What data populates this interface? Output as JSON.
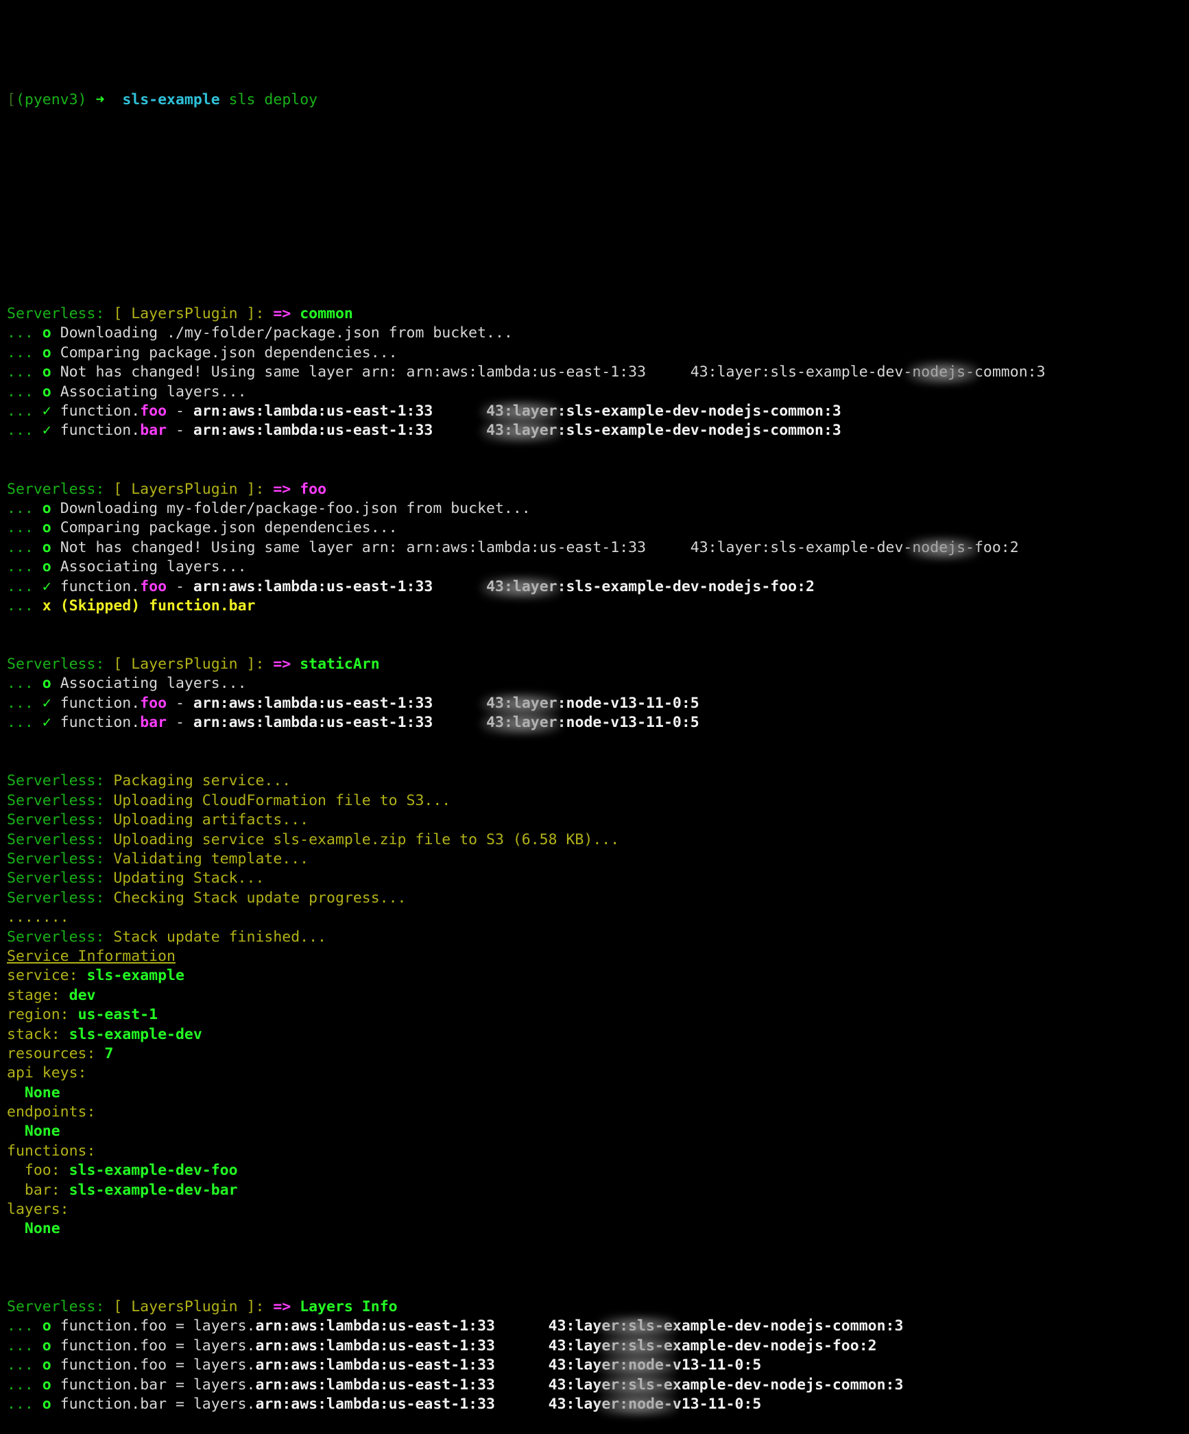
{
  "terminal": {
    "theme": {
      "background": "#000000",
      "green": "#18b218",
      "bright_green": "#23fd23",
      "yellow": "#b2b218",
      "bright_yellow": "#f0f023",
      "cyan": "#2fc0d8",
      "magenta": "#e619e6",
      "white": "#d8d8d8"
    },
    "prompt": {
      "bracket": "[",
      "venv": "(pyenv3)",
      "arrow": "➜",
      "cwd": "sls-example",
      "command": "sls deploy"
    },
    "account_redacted": true,
    "arn_prefix": "arn:aws:lambda:us-east-1:33",
    "arn_suffix_digits": "43",
    "blocks": [
      {
        "header": {
          "prefix": "Serverless:",
          "plugin": "[ LayersPlugin ]:",
          "arrow": "=>",
          "name": "common",
          "name_color": "bright_green"
        },
        "lines": [
          {
            "kind": "info",
            "bullet": "o",
            "text": "Downloading ./my-folder/package.json from bucket..."
          },
          {
            "kind": "info",
            "bullet": "o",
            "text": "Comparing package.json dependencies..."
          },
          {
            "kind": "arn-info",
            "bullet": "o",
            "text": "Not has changed! Using same layer arn: ",
            "arn_tail": ":layer:sls-example-dev-nodejs-common:3"
          },
          {
            "kind": "info",
            "bullet": "o",
            "text": "Associating layers..."
          },
          {
            "kind": "ok-arn",
            "bullet": "✓",
            "fn_prefix": "function.",
            "fn": "foo",
            "sep": " - ",
            "arn_tail": ":layer:sls-example-dev-nodejs-common:3"
          },
          {
            "kind": "ok-arn",
            "bullet": "✓",
            "fn_prefix": "function.",
            "fn": "bar",
            "sep": " - ",
            "arn_tail": ":layer:sls-example-dev-nodejs-common:3"
          }
        ]
      },
      {
        "header": {
          "prefix": "Serverless:",
          "plugin": "[ LayersPlugin ]:",
          "arrow": "=>",
          "name": "foo",
          "name_color": "magenta"
        },
        "lines": [
          {
            "kind": "info",
            "bullet": "o",
            "text": "Downloading my-folder/package-foo.json from bucket..."
          },
          {
            "kind": "info",
            "bullet": "o",
            "text": "Comparing package.json dependencies..."
          },
          {
            "kind": "arn-info",
            "bullet": "o",
            "text": "Not has changed! Using same layer arn: ",
            "arn_tail": ":layer:sls-example-dev-nodejs-foo:2"
          },
          {
            "kind": "info",
            "bullet": "o",
            "text": "Associating layers..."
          },
          {
            "kind": "ok-arn",
            "bullet": "✓",
            "fn_prefix": "function.",
            "fn": "foo",
            "sep": " - ",
            "arn_tail": ":layer:sls-example-dev-nodejs-foo:2"
          },
          {
            "kind": "skip",
            "bullet": "x",
            "text": "(Skipped) function.bar"
          }
        ]
      },
      {
        "header": {
          "prefix": "Serverless:",
          "plugin": "[ LayersPlugin ]:",
          "arrow": "=>",
          "name": "staticArn",
          "name_color": "bright_green"
        },
        "lines": [
          {
            "kind": "info",
            "bullet": "o",
            "text": "Associating layers..."
          },
          {
            "kind": "ok-arn",
            "bullet": "✓",
            "fn_prefix": "function.",
            "fn": "foo",
            "sep": " - ",
            "arn_tail": ":layer:node-v13-11-0:5"
          },
          {
            "kind": "ok-arn",
            "bullet": "✓",
            "fn_prefix": "function.",
            "fn": "bar",
            "sep": " - ",
            "arn_tail": ":layer:node-v13-11-0:5"
          }
        ]
      }
    ],
    "status_lines": [
      {
        "prefix": "Serverless:",
        "text": "Packaging service..."
      },
      {
        "prefix": "Serverless:",
        "text": "Uploading CloudFormation file to S3..."
      },
      {
        "prefix": "Serverless:",
        "text": "Uploading artifacts..."
      },
      {
        "prefix": "Serverless:",
        "text": "Uploading service sls-example.zip file to S3 (6.58 KB)..."
      },
      {
        "prefix": "Serverless:",
        "text": "Validating template..."
      },
      {
        "prefix": "Serverless:",
        "text": "Updating Stack..."
      },
      {
        "prefix": "Serverless:",
        "text": "Checking Stack update progress..."
      }
    ],
    "progress_dots": ".......",
    "finished_line": {
      "prefix": "Serverless:",
      "text": "Stack update finished..."
    },
    "service_information": {
      "title": "Service Information",
      "rows": [
        {
          "key": "service:",
          "value": "sls-example",
          "indent": 0
        },
        {
          "key": "stage:",
          "value": "dev",
          "indent": 0
        },
        {
          "key": "region:",
          "value": "us-east-1",
          "indent": 0
        },
        {
          "key": "stack:",
          "value": "sls-example-dev",
          "indent": 0
        },
        {
          "key": "resources:",
          "value": "7",
          "indent": 0
        },
        {
          "key": "api keys:",
          "value": "",
          "indent": 0
        },
        {
          "key": "",
          "value": "None",
          "indent": 1
        },
        {
          "key": "endpoints:",
          "value": "",
          "indent": 0
        },
        {
          "key": "",
          "value": "None",
          "indent": 1
        },
        {
          "key": "functions:",
          "value": "",
          "indent": 0
        },
        {
          "key": "foo:",
          "value": "sls-example-dev-foo",
          "indent": 1
        },
        {
          "key": "bar:",
          "value": "sls-example-dev-bar",
          "indent": 1
        },
        {
          "key": "layers:",
          "value": "",
          "indent": 0
        },
        {
          "key": "",
          "value": "None",
          "indent": 1
        }
      ]
    },
    "layers_info": {
      "header": {
        "prefix": "Serverless:",
        "plugin": "[ LayersPlugin ]:",
        "arrow": "=>",
        "name": "Layers Info",
        "name_color": "bright_green"
      },
      "rows": [
        {
          "bullet": "o",
          "lhs": "function.foo = layers.",
          "arn_tail": ":layer:sls-example-dev-nodejs-common:3"
        },
        {
          "bullet": "o",
          "lhs": "function.foo = layers.",
          "arn_tail": ":layer:sls-example-dev-nodejs-foo:2"
        },
        {
          "bullet": "o",
          "lhs": "function.foo = layers.",
          "arn_tail": ":layer:node-v13-11-0:5"
        },
        {
          "bullet": "o",
          "lhs": "function.bar = layers.",
          "arn_tail": ":layer:sls-example-dev-nodejs-common:3"
        },
        {
          "bullet": "o",
          "lhs": "function.bar = layers.",
          "arn_tail": ":layer:node-v13-11-0:5"
        }
      ]
    }
  }
}
